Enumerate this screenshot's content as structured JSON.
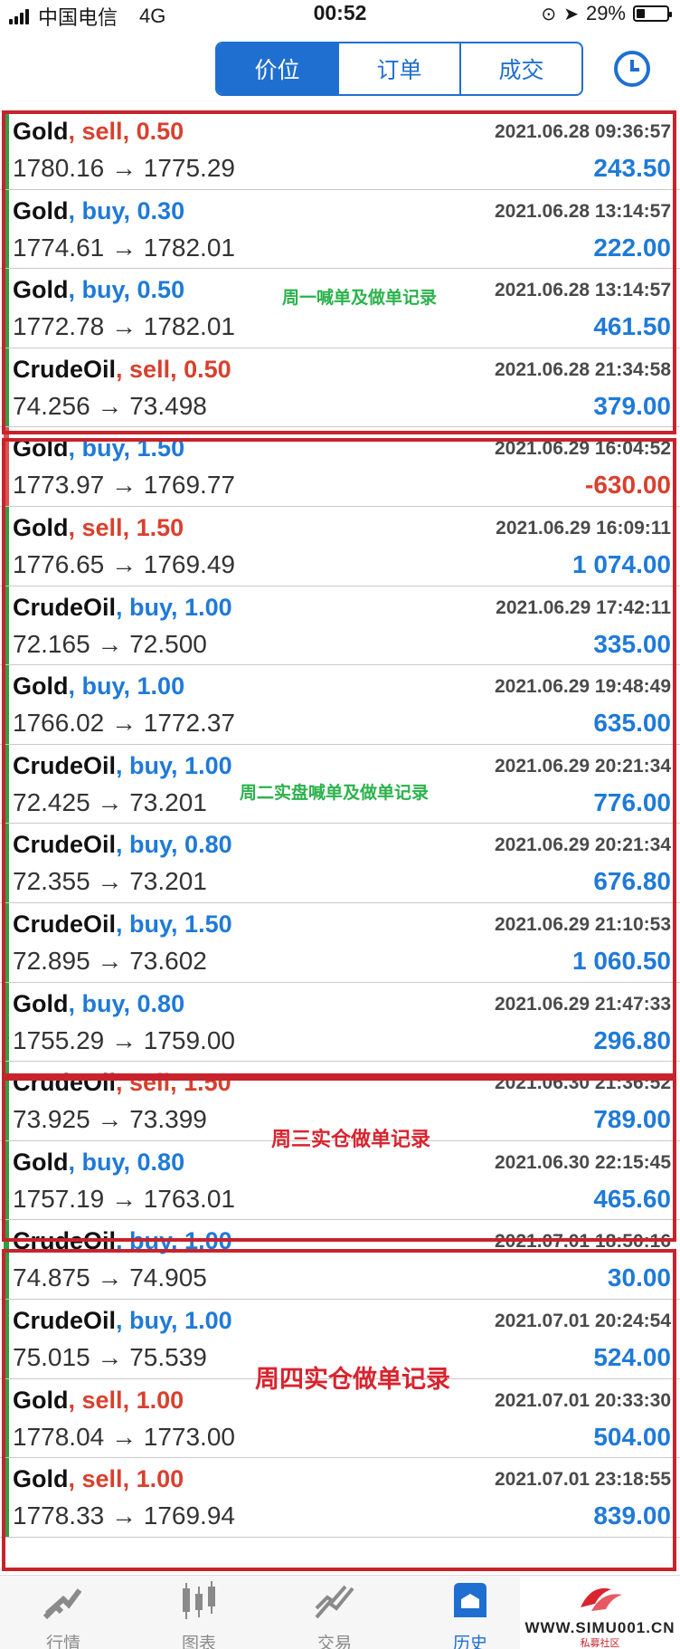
{
  "status_bar": {
    "carrier": "中国电信",
    "network": "4G",
    "time": "00:52",
    "battery": "29%",
    "battery_level": 0.29
  },
  "header": {
    "tabs": [
      "价位",
      "订单",
      "成交"
    ],
    "active_tab": "价位",
    "history_icon": "clock-icon"
  },
  "colors": {
    "accent": "#1f6fd1",
    "sell": "#d9402e",
    "buy": "#1f7ad8",
    "profit": "#1f7ad8",
    "loss": "#d9402e",
    "highlight_box": "#c8232c"
  },
  "trades": [
    {
      "symbol": "Gold",
      "side": "sell",
      "volume": "0.50",
      "datetime": "2021.06.28 09:36:57",
      "price": "1780.16 → 1775.29",
      "profit": "243.50"
    },
    {
      "symbol": "Gold",
      "side": "buy",
      "volume": "0.30",
      "datetime": "2021.06.28 13:14:57",
      "price": "1774.61 → 1782.01",
      "profit": "222.00"
    },
    {
      "symbol": "Gold",
      "side": "buy",
      "volume": "0.50",
      "datetime": "2021.06.28 13:14:57",
      "price": "1772.78 → 1782.01",
      "profit": "461.50"
    },
    {
      "symbol": "CrudeOil",
      "side": "sell",
      "volume": "0.50",
      "datetime": "2021.06.28 21:34:58",
      "price": "74.256 → 73.498",
      "profit": "379.00"
    },
    {
      "symbol": "Gold",
      "side": "buy",
      "volume": "1.50",
      "datetime": "2021.06.29 16:04:52",
      "price": "1773.97 → 1769.77",
      "profit": "-630.00"
    },
    {
      "symbol": "Gold",
      "side": "sell",
      "volume": "1.50",
      "datetime": "2021.06.29 16:09:11",
      "price": "1776.65 → 1769.49",
      "profit": "1 074.00"
    },
    {
      "symbol": "CrudeOil",
      "side": "buy",
      "volume": "1.00",
      "datetime": "2021.06.29 17:42:11",
      "price": "72.165 → 72.500",
      "profit": "335.00"
    },
    {
      "symbol": "Gold",
      "side": "buy",
      "volume": "1.00",
      "datetime": "2021.06.29 19:48:49",
      "price": "1766.02 → 1772.37",
      "profit": "635.00"
    },
    {
      "symbol": "CrudeOil",
      "side": "buy",
      "volume": "1.00",
      "datetime": "2021.06.29 20:21:34",
      "price": "72.425 → 73.201",
      "profit": "776.00"
    },
    {
      "symbol": "CrudeOil",
      "side": "buy",
      "volume": "0.80",
      "datetime": "2021.06.29 20:21:34",
      "price": "72.355 → 73.201",
      "profit": "676.80"
    },
    {
      "symbol": "CrudeOil",
      "side": "buy",
      "volume": "1.50",
      "datetime": "2021.06.29 21:10:53",
      "price": "72.895 → 73.602",
      "profit": "1 060.50"
    },
    {
      "symbol": "Gold",
      "side": "buy",
      "volume": "0.80",
      "datetime": "2021.06.29 21:47:33",
      "price": "1755.29 → 1759.00",
      "profit": "296.80"
    },
    {
      "symbol": "CrudeOil",
      "side": "sell",
      "volume": "1.50",
      "datetime": "2021.06.30 21:36:52",
      "price": "73.925 → 73.399",
      "profit": "789.00"
    },
    {
      "symbol": "Gold",
      "side": "buy",
      "volume": "0.80",
      "datetime": "2021.06.30 22:15:45",
      "price": "1757.19 → 1763.01",
      "profit": "465.60"
    },
    {
      "symbol": "CrudeOil",
      "side": "buy",
      "volume": "1.00",
      "datetime": "2021.07.01 18:50:16",
      "price": "74.875 → 74.905",
      "profit": "30.00"
    },
    {
      "symbol": "CrudeOil",
      "side": "buy",
      "volume": "1.00",
      "datetime": "2021.07.01 20:24:54",
      "price": "75.015 → 75.539",
      "profit": "524.00"
    },
    {
      "symbol": "Gold",
      "side": "sell",
      "volume": "1.00",
      "datetime": "2021.07.01 20:33:30",
      "price": "1778.04 → 1773.00",
      "profit": "504.00"
    },
    {
      "symbol": "Gold",
      "side": "sell",
      "volume": "1.00",
      "datetime": "2021.07.01 23:18:55",
      "price": "1778.33 → 1769.94",
      "profit": "839.00"
    }
  ],
  "annotations": {
    "monday": "周一喊单及做单记录",
    "tuesday": "周二实盘喊单及做单记录",
    "wednesday": "周三实仓做单记录",
    "thursday": "周四实仓做单记录"
  },
  "tabbar": {
    "items": [
      {
        "label": "行情",
        "icon": "quotes-icon"
      },
      {
        "label": "图表",
        "icon": "chart-icon"
      },
      {
        "label": "交易",
        "icon": "trade-icon"
      },
      {
        "label": "历史",
        "icon": "history-icon"
      }
    ],
    "active": "历史"
  },
  "watermark": {
    "url": "WWW.SIMU001.CN",
    "sub": "私募社区"
  }
}
